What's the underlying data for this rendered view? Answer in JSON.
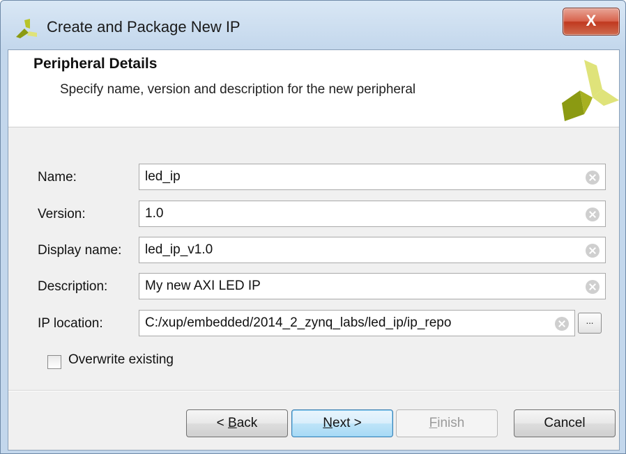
{
  "window": {
    "title": "Create and Package New IP",
    "close_label": "X"
  },
  "header": {
    "title": "Peripheral Details",
    "subtitle": "Specify name, version and description for the new peripheral"
  },
  "form": {
    "fields": [
      {
        "label": "Name:",
        "value": "led_ip"
      },
      {
        "label": "Version:",
        "value": "1.0"
      },
      {
        "label": "Display name:",
        "value": "led_ip_v1.0"
      },
      {
        "label": "Description:",
        "value": "My new AXI LED IP"
      },
      {
        "label": "IP location:",
        "value": "C:/xup/embedded/2014_2_zynq_labs/led_ip/ip_repo"
      }
    ],
    "browse_label": "...",
    "overwrite": {
      "label": "Overwrite existing",
      "checked": false
    }
  },
  "buttons": {
    "back": {
      "pre": "< ",
      "accel": "B",
      "post": "ack"
    },
    "next": {
      "pre": "",
      "accel": "N",
      "post": "ext >"
    },
    "finish": {
      "pre": "",
      "accel": "F",
      "post": "inish"
    },
    "cancel": {
      "label": "Cancel"
    }
  },
  "colors": {
    "accent": "#3c7fb1",
    "logo_dark": "#8b9a12",
    "logo_light": "#dfe37a"
  },
  "icons": {
    "title": "vivado-logo-icon",
    "clear": "clear-field-icon",
    "browse": "browse-icon"
  }
}
